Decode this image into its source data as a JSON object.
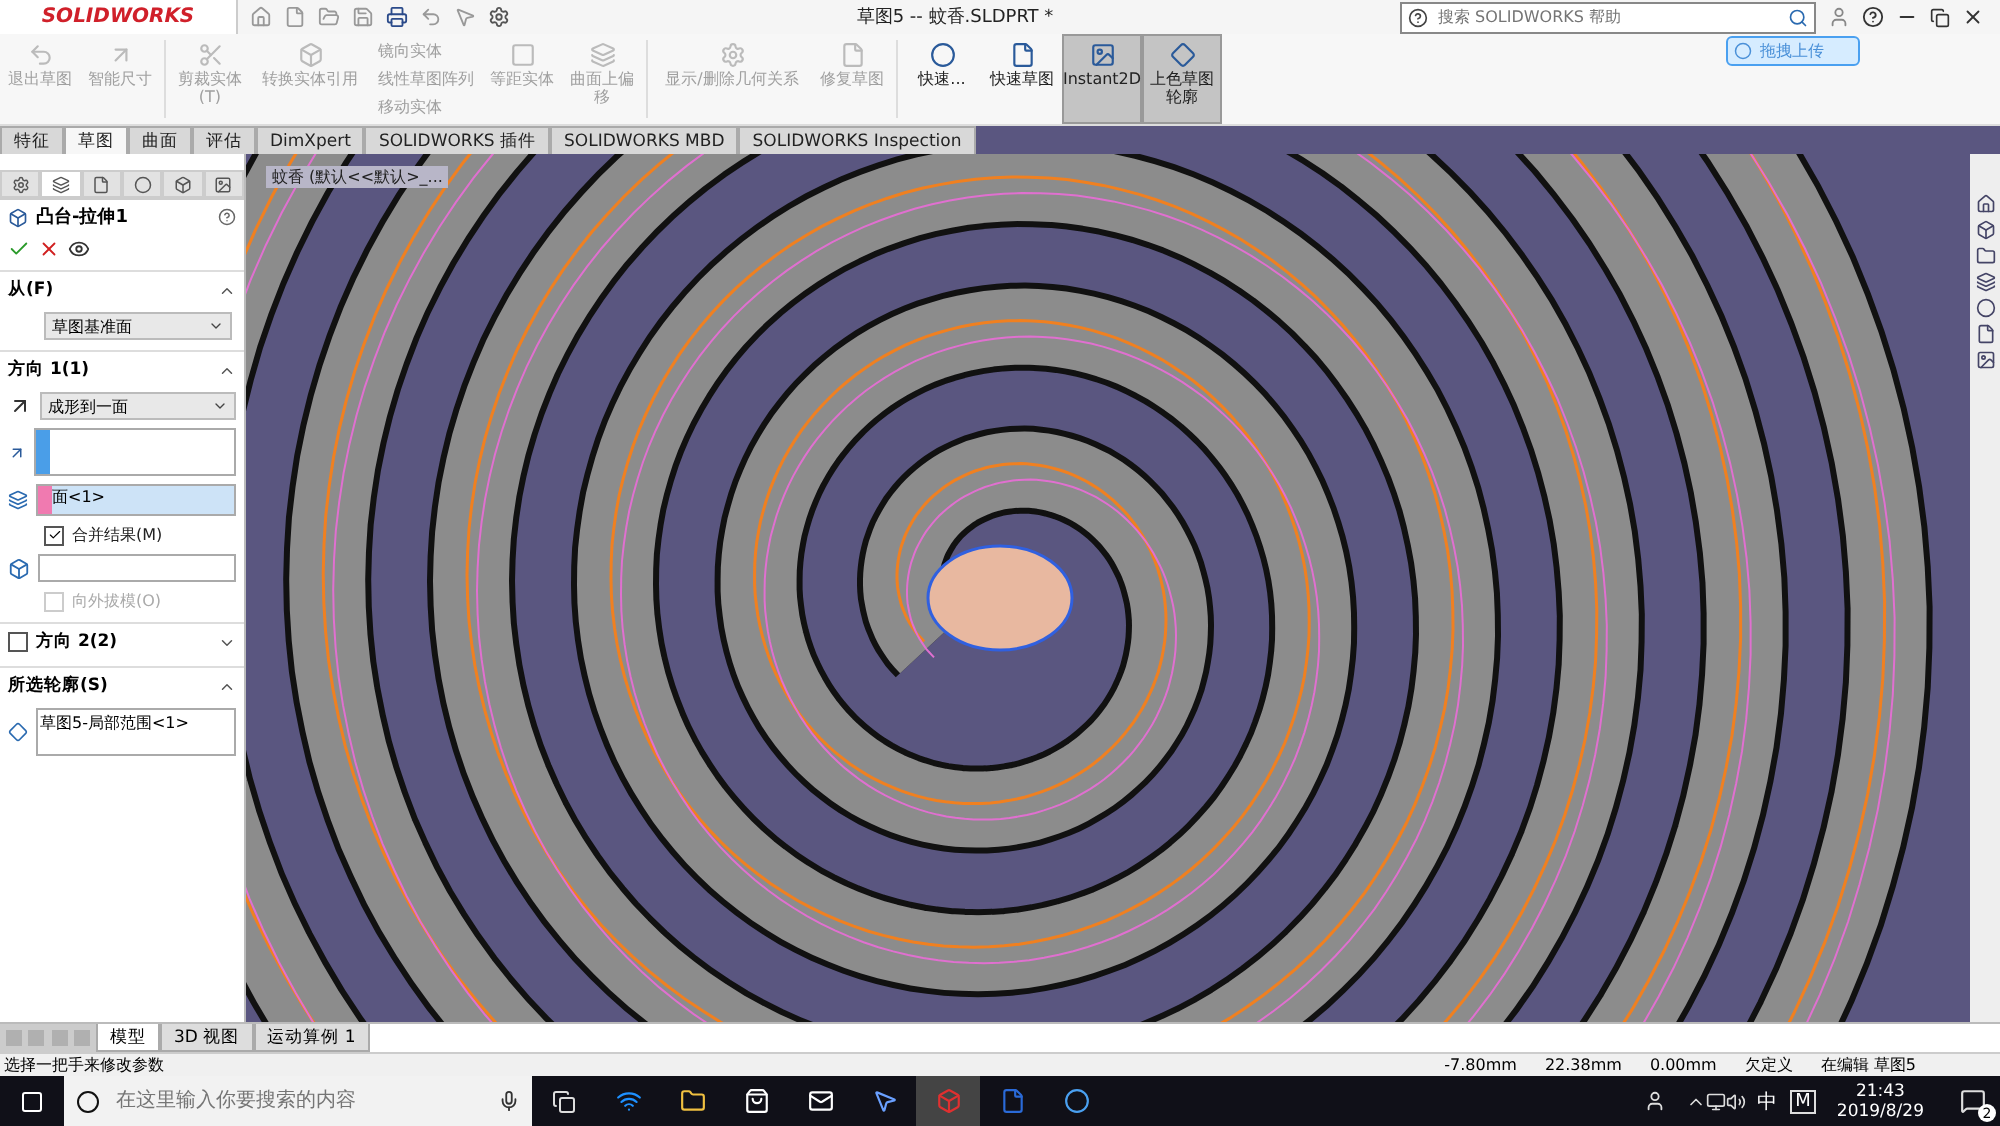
{
  "app": {
    "logo": "SOLIDWORKS",
    "title": "草图5 -- 蚊香.SLDPRT *",
    "search": {
      "placeholder": "搜索 SOLIDWORKS 帮助"
    },
    "upload_button": "拖拽上传"
  },
  "command_manager": [
    {
      "label": "退出草图",
      "disabled": true,
      "selected": false
    },
    {
      "label": "智能尺寸",
      "disabled": true,
      "selected": false
    },
    {
      "label": "剪裁实体(T)",
      "disabled": true,
      "selected": false
    },
    {
      "label": "转换实体引用",
      "disabled": true,
      "selected": false
    },
    {
      "label": "等距实体",
      "disabled": true,
      "selected": false
    },
    {
      "label": "曲面上偏移",
      "disabled": true,
      "selected": false
    },
    {
      "label": "显示/删除几何关系",
      "disabled": true,
      "selected": false
    },
    {
      "label": "修复草图",
      "disabled": true,
      "selected": false
    },
    {
      "label": "快速...",
      "disabled": false,
      "selected": false
    },
    {
      "label": "快速草图",
      "disabled": false,
      "selected": false
    },
    {
      "label": "Instant2D",
      "disabled": false,
      "selected": true
    },
    {
      "label": "上色草图轮廓",
      "disabled": false,
      "selected": true
    }
  ],
  "small_commands": [
    {
      "label": "镜向实体",
      "disabled": true
    },
    {
      "label": "线性草图阵列",
      "disabled": true
    },
    {
      "label": "移动实体",
      "disabled": true
    }
  ],
  "tabs": [
    {
      "label": "特征",
      "selected": false
    },
    {
      "label": "草图",
      "selected": true
    },
    {
      "label": "曲面",
      "selected": false
    },
    {
      "label": "评估",
      "selected": false
    },
    {
      "label": "DimXpert",
      "selected": false
    },
    {
      "label": "SOLIDWORKS 插件",
      "selected": false
    },
    {
      "label": "SOLIDWORKS MBD",
      "selected": false
    },
    {
      "label": "SOLIDWORKS Inspection",
      "selected": false
    }
  ],
  "panel_tabs": [
    {
      "selected": false
    },
    {
      "selected": true
    },
    {
      "selected": false
    },
    {
      "selected": false
    },
    {
      "selected": false
    },
    {
      "selected": false
    }
  ],
  "property_manager": {
    "title": "凸台-拉伸1",
    "from": {
      "label": "从(F)",
      "value": "草图基准面"
    },
    "direction1": {
      "label": "方向 1(1)",
      "end_condition": "成形到一面",
      "face": "面<1>",
      "merge": {
        "label": "合并结果(M)",
        "checked": true
      },
      "draft": {
        "label": "向外拔模(O)",
        "checked": false,
        "disabled": true
      }
    },
    "direction2": {
      "label": "方向 2(2)",
      "checked": false
    },
    "profiles": {
      "label": "所选轮廓(S)",
      "items": [
        "草图5-局部范围<1>"
      ]
    }
  },
  "viewport": {
    "breadcrumb": "蚊香 (默认<<默认>_..."
  },
  "bottom_tabs": [
    {
      "label": "模型",
      "selected": true
    },
    {
      "label": "3D 视图",
      "selected": false
    },
    {
      "label": "运动算例 1",
      "selected": false
    }
  ],
  "status_bar": {
    "message": "选择一把手来修改参数",
    "readouts": [
      "-7.80mm",
      "22.38mm",
      "0.00mm",
      "欠定义",
      "在编辑 草图5"
    ]
  },
  "taskbar": {
    "search_placeholder": "在这里输入你要搜索的内容",
    "ime": "中",
    "ime_mode": "M",
    "time": "21:43",
    "date": "2019/8/29",
    "notifications": "2"
  }
}
